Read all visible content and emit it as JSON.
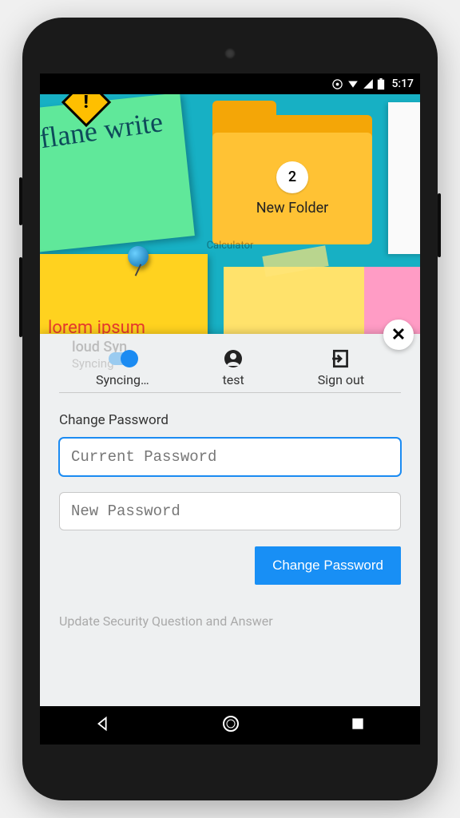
{
  "status": {
    "time": "5:17"
  },
  "notes": {
    "green_handwriting": "flane\nwrite",
    "yellow_text": "lorem ipsum",
    "folder_count": "2",
    "folder_label": "New Folder"
  },
  "faded": {
    "a": "",
    "b": "Calculator",
    "c": ""
  },
  "sheet": {
    "ghost_title": "loud Syn",
    "ghost_sub": "Syncing",
    "tabs": {
      "sync": "Syncing…",
      "user": "test",
      "signout": "Sign out"
    },
    "form": {
      "heading": "Change Password",
      "current_placeholder": "Current Password",
      "new_placeholder": "New Password",
      "submit": "Change Password"
    },
    "footer": "Update Security Question and Answer"
  }
}
